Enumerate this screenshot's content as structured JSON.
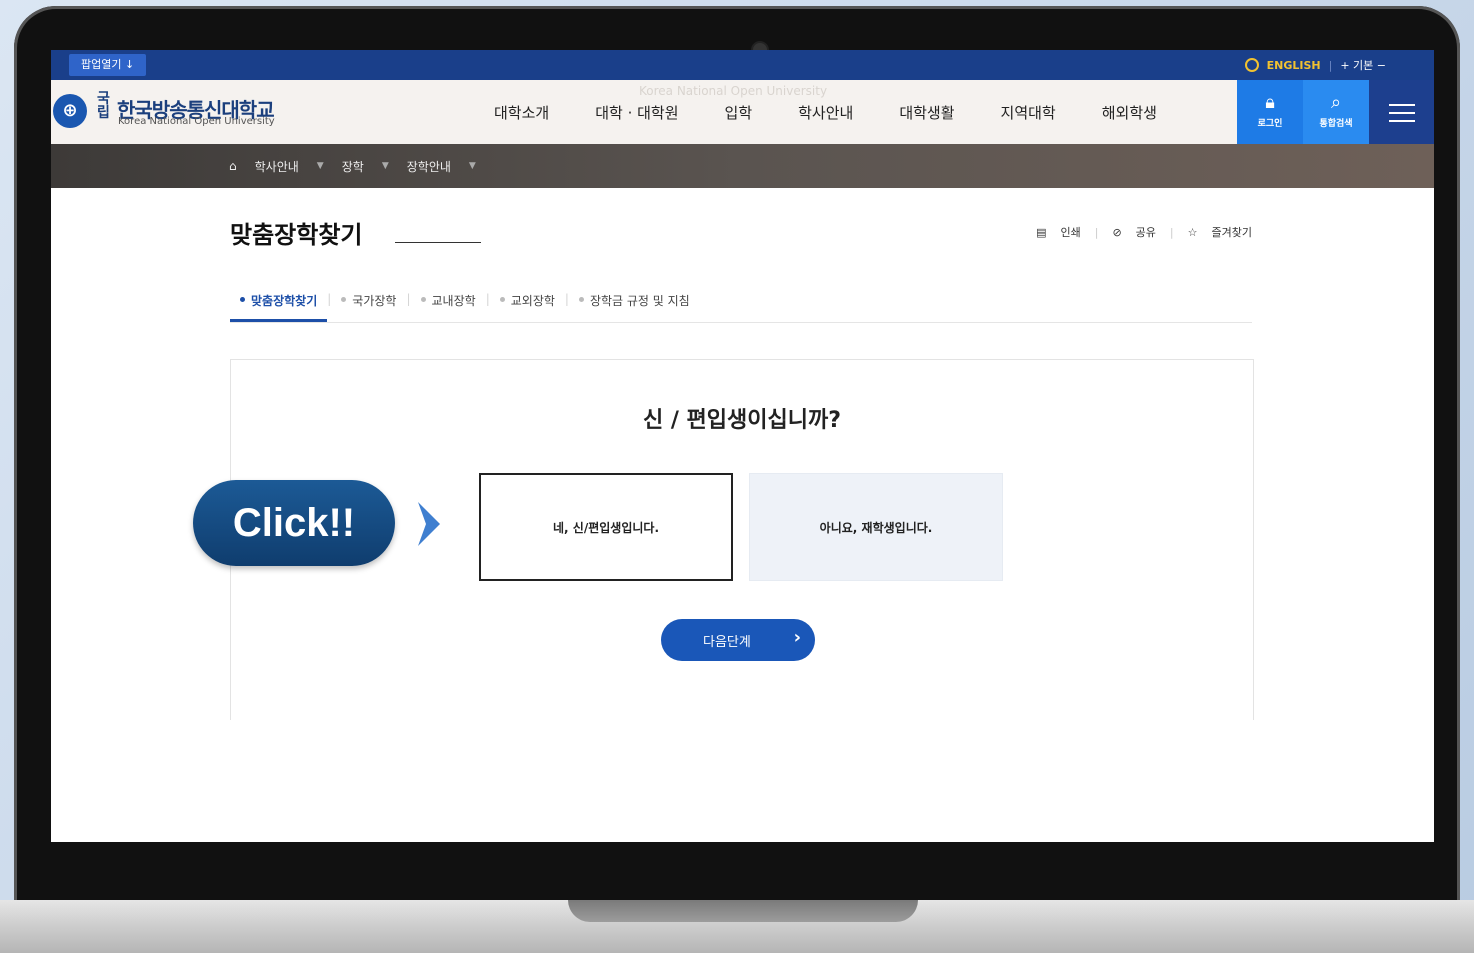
{
  "utility_bar": {
    "popup_label": "팝업열기 ↓",
    "language": "ENGLISH",
    "font_size_label": "+ 기본 −"
  },
  "header": {
    "logo_kuk": "국립",
    "logo_name": "한국방송통신대학교",
    "logo_sub": "Korea National Open University",
    "watermark": "Korea National Open University",
    "nav": [
      "대학소개",
      "대학 · 대학원",
      "입학",
      "학사안내",
      "대학생활",
      "지역대학",
      "해외학생"
    ],
    "login_label": "로그인",
    "search_label": "통합검색"
  },
  "breadcrumb": {
    "items": [
      "학사안내",
      "장학",
      "장학안내"
    ]
  },
  "page": {
    "title": "맞춤장학찾기",
    "tools": [
      "인쇄",
      "공유",
      "즐겨찾기"
    ]
  },
  "tabs": [
    {
      "label": "맞춤장학찾기",
      "active": true
    },
    {
      "label": "국가장학",
      "active": false
    },
    {
      "label": "교내장학",
      "active": false
    },
    {
      "label": "교외장학",
      "active": false
    },
    {
      "label": "장학금 규정 및 지침",
      "active": false
    }
  ],
  "question": {
    "text": "신 / 편입생이십니까?",
    "option_yes": "네, 신/편입생입니다.",
    "option_no": "아니요, 재학생입니다.",
    "next_label": "다음단계"
  },
  "callout": {
    "label": "Click!!"
  },
  "colors": {
    "primary": "#1a57b8",
    "utility_bar": "#1a3f8a",
    "callout": "#0f3d6e"
  }
}
